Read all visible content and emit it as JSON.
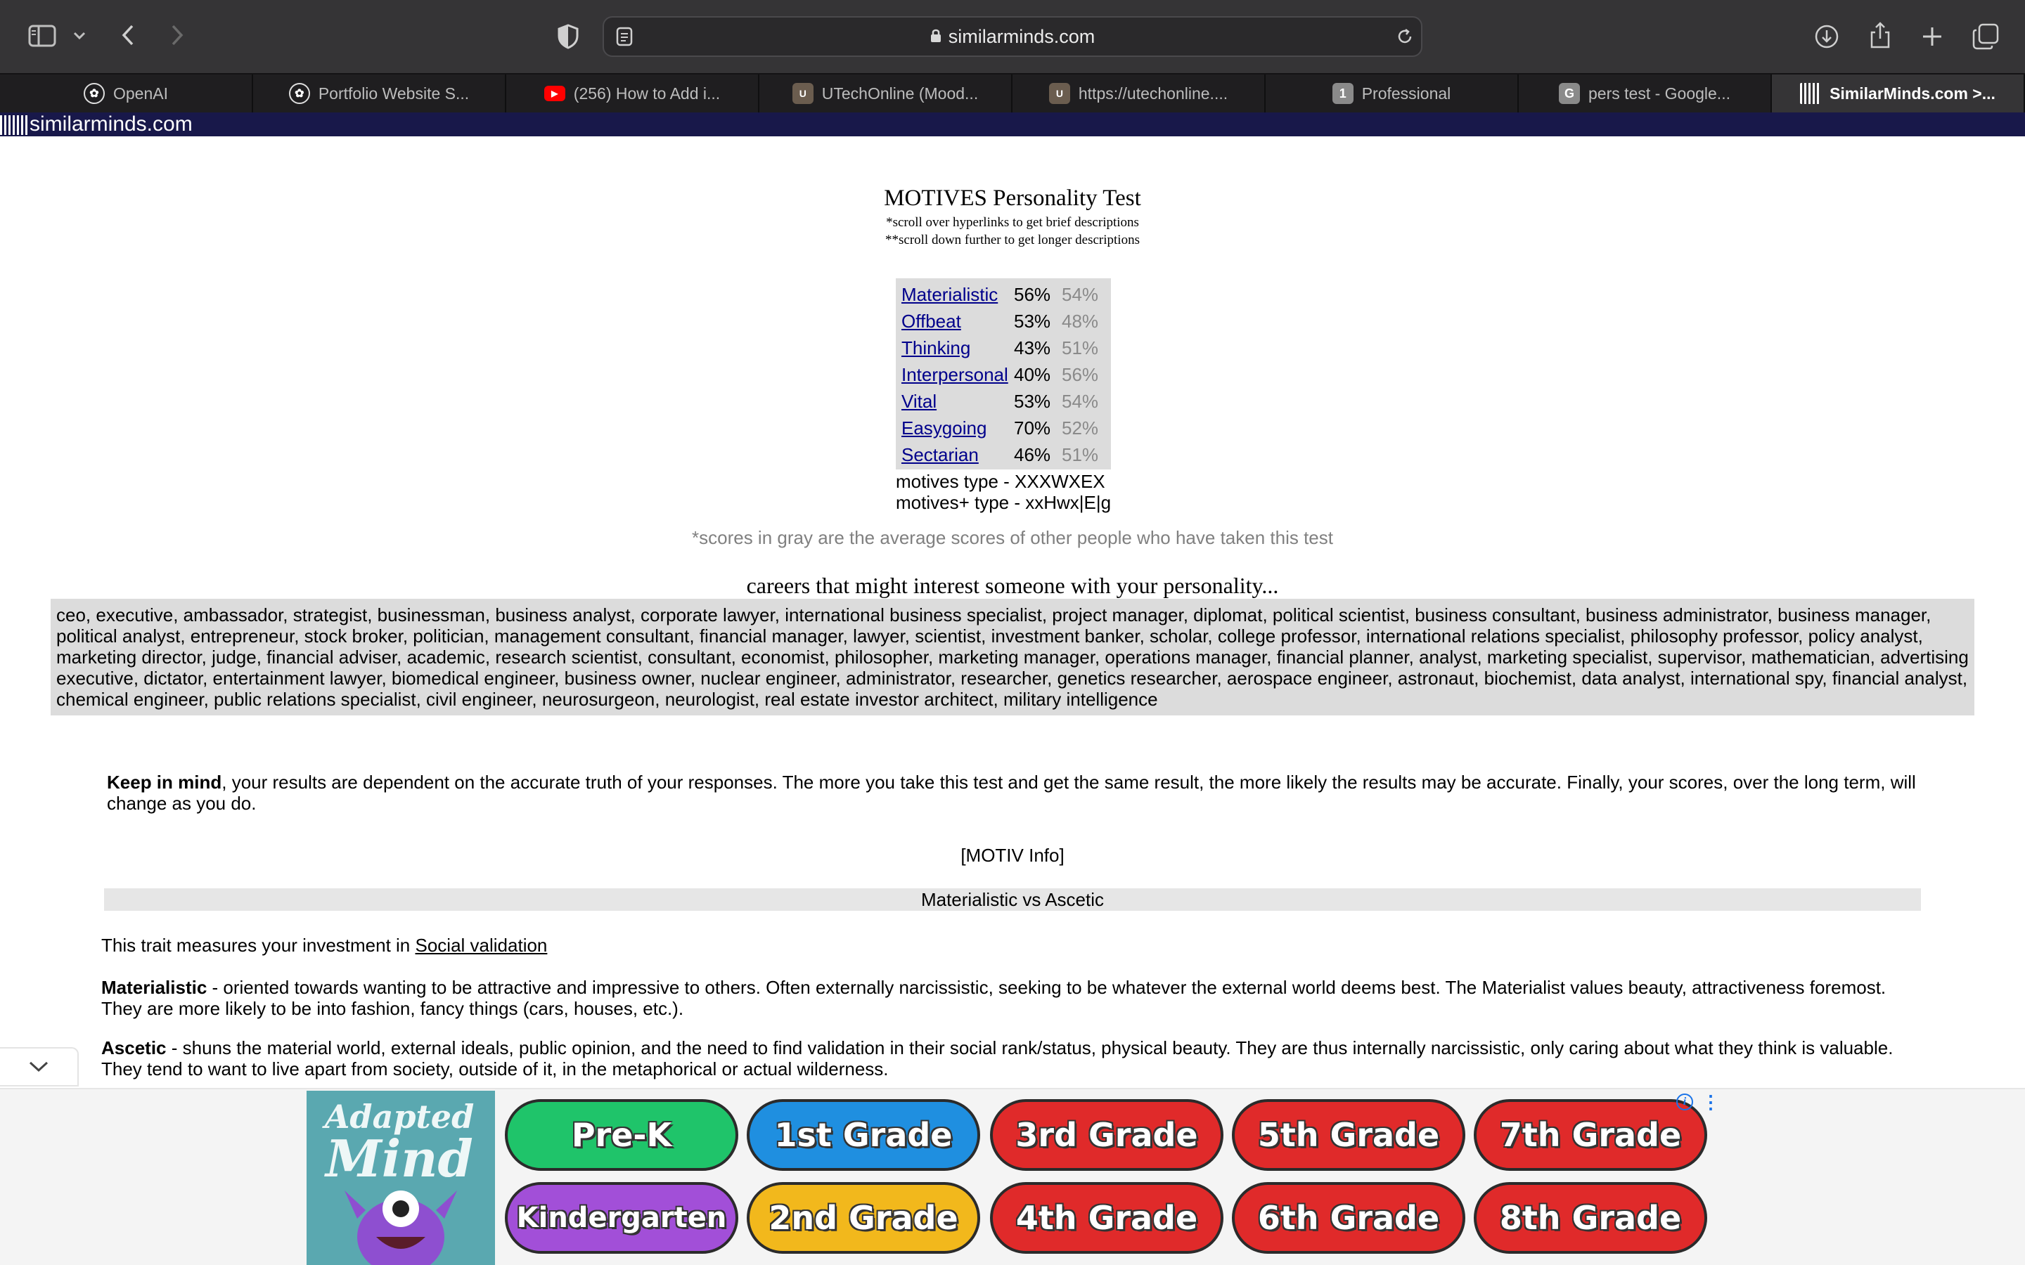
{
  "browser": {
    "url": "similarminds.com",
    "tabs": [
      {
        "label": "OpenAI",
        "icon": "openai-icon",
        "active": false
      },
      {
        "label": "Portfolio Website S...",
        "icon": "openai-icon",
        "active": false
      },
      {
        "label": "(256) How to Add i...",
        "icon": "youtube-icon",
        "active": false
      },
      {
        "label": "UTechOnline (Mood...",
        "icon": "utech-icon",
        "active": false
      },
      {
        "label": "https://utechonline....",
        "icon": "utech-icon",
        "active": false
      },
      {
        "label": "Professional",
        "icon": "number-badge-icon",
        "badge": "1",
        "active": false
      },
      {
        "label": "pers test - Google...",
        "icon": "google-icon",
        "badge": "G",
        "active": false
      },
      {
        "label": "SimilarMinds.com >...",
        "icon": "similarminds-icon",
        "active": true
      }
    ]
  },
  "site": {
    "name": "similarminds.com"
  },
  "test": {
    "title": "MOTIVES Personality Test",
    "note1": "*scroll over hyperlinks to get brief descriptions",
    "note2": "**scroll down further to get longer descriptions",
    "scores": [
      {
        "trait": "Materialistic",
        "score": "56%",
        "avg": "54%"
      },
      {
        "trait": "Offbeat",
        "score": "53%",
        "avg": "48%"
      },
      {
        "trait": "Thinking",
        "score": "43%",
        "avg": "51%"
      },
      {
        "trait": "Interpersonal",
        "score": "40%",
        "avg": "56%"
      },
      {
        "trait": "Vital",
        "score": "53%",
        "avg": "54%"
      },
      {
        "trait": "Easygoing",
        "score": "70%",
        "avg": "52%"
      },
      {
        "trait": "Sectarian",
        "score": "46%",
        "avg": "51%"
      }
    ],
    "type_line": "motives type - XXXWXEX",
    "type_plus_line": "motives+ type - xxHwx|E|g",
    "gray_note": "*scores in gray are the average scores of other people who have taken this test",
    "careers_title": "careers that might interest someone with your personality...",
    "careers": "ceo, executive, ambassador, strategist, businessman, business analyst, corporate lawyer, international business specialist, project manager, diplomat, political scientist, business consultant, business administrator, business manager, political analyst, entrepreneur, stock broker, politician, management consultant, financial manager, lawyer, scientist, investment banker, scholar, college professor, international relations specialist, philosophy professor, policy analyst, marketing director, judge, financial adviser, academic, research scientist, consultant, economist, philosopher, marketing manager, operations manager, financial planner, analyst, marketing specialist, supervisor, mathematician, advertising executive, dictator, entertainment lawyer, biomedical engineer, business owner, nuclear engineer, administrator, researcher, genetics researcher, aerospace engineer, astronaut, biochemist, data analyst, international spy, financial analyst, chemical engineer, public relations specialist, civil engineer, neurosurgeon, neurologist, real estate investor architect, military intelligence"
  },
  "info": {
    "keep_bold": "Keep in mind",
    "keep_rest": ", your results are dependent on the accurate truth of your responses. The more you take this test and get the same result, the more likely the results may be accurate. Finally, your scores, over the long term, will change as you do.",
    "motiv_info": "[MOTIV Info]",
    "trait_header": "Materialistic vs Ascetic",
    "measure_prefix": "This trait measures your investment in ",
    "measure_link": "Social validation",
    "materialistic_bold": "Materialistic",
    "materialistic_rest": " - oriented towards wanting to be attractive and impressive to others. Often externally narcissistic, seeking to be whatever the external world deems best. The Materialist values beauty, attractiveness foremost. They are more likely to be into fashion, fancy things (cars, houses, etc.).",
    "ascetic_bold": "Ascetic",
    "ascetic_rest": " - shuns the material world, external ideals, public opinion, and the need to find validation in their social rank/status, physical beauty. They are thus internally narcissistic, only caring about what they think is valuable. They tend to want to live apart from society, outside of it, in the metaphorical or actual wilderness."
  },
  "ad": {
    "logo_line1": "Adapted",
    "logo_line2": "Mind",
    "buttons": [
      {
        "label": "Pre-K",
        "color": "#1fc46a"
      },
      {
        "label": "1st Grade",
        "color": "#1f8fe0"
      },
      {
        "label": "3rd Grade",
        "color": "#e02a2a"
      },
      {
        "label": "5th Grade",
        "color": "#e02a2a"
      },
      {
        "label": "7th Grade",
        "color": "#e02a2a"
      },
      {
        "label": "Kindergarten",
        "color": "#a24fd8"
      },
      {
        "label": "2nd Grade",
        "color": "#f2b81c"
      },
      {
        "label": "4th Grade",
        "color": "#e02a2a"
      },
      {
        "label": "6th Grade",
        "color": "#e02a2a"
      },
      {
        "label": "8th Grade",
        "color": "#e02a2a"
      }
    ]
  }
}
